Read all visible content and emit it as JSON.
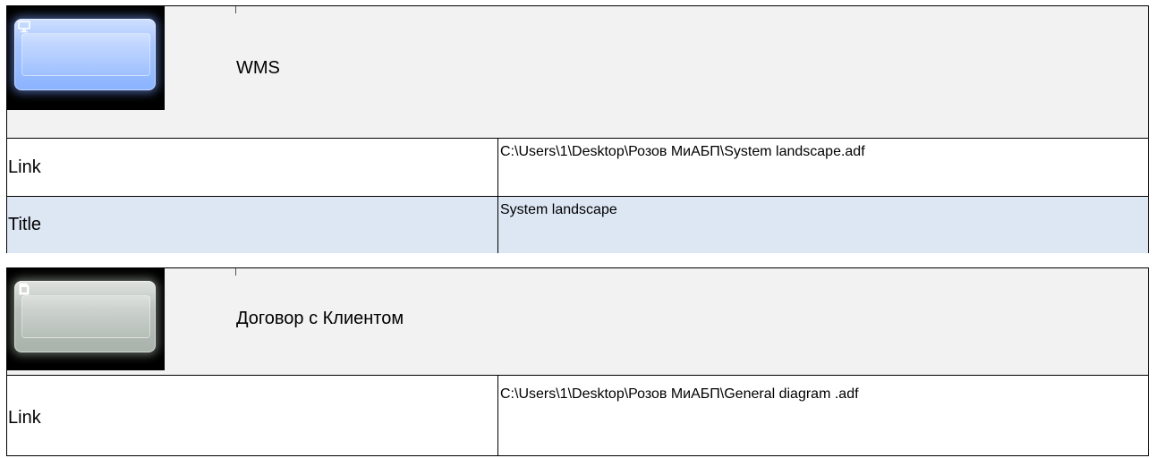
{
  "cards": [
    {
      "title": "WMS",
      "thumbnail": {
        "icon": "monitor-icon",
        "color": "#8ab3ff"
      },
      "rows": [
        {
          "label": "Link",
          "value": "C:\\Users\\1\\Desktop\\Розов МиАБП\\System landscape.adf"
        },
        {
          "label": "Title",
          "value": "System landscape"
        }
      ]
    },
    {
      "title": "Договор с Клиентом",
      "thumbnail": {
        "icon": "document-icon",
        "color": "#a9b2ab"
      },
      "rows": [
        {
          "label": "Link",
          "value": "C:\\Users\\1\\Desktop\\Розов МиАБП\\General diagram .adf"
        }
      ]
    }
  ],
  "colors": {
    "header_bg": "#f2f2f2",
    "alt_row_bg": "#dde7f4",
    "border": "#000000"
  }
}
